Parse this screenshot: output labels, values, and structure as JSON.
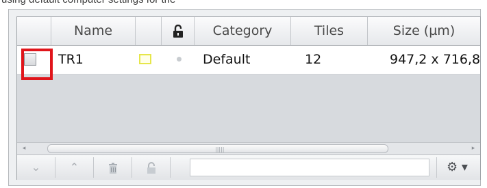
{
  "caption": "using default computer settings for the",
  "table": {
    "columns": {
      "name": "Name",
      "lock_icon": "lock-open-icon",
      "category": "Category",
      "tiles": "Tiles",
      "size": "Size (µm)"
    },
    "rows": [
      {
        "checked": false,
        "name": "TR1",
        "color": "#e6e64a",
        "category": "Default",
        "tiles": "12",
        "size": "947,2 x 716,8"
      }
    ]
  },
  "scrollbar": {
    "left_arrow": "◂",
    "right_arrow": "▸",
    "grip": "|||||"
  },
  "toolbar": {
    "move_down": "⌄",
    "move_up": "⌃",
    "delete": "🗑",
    "lock": "🔒",
    "settings": "⚙ ▾"
  },
  "colors": {
    "highlight": "#e0151b",
    "swatch": "#e6e64a"
  }
}
